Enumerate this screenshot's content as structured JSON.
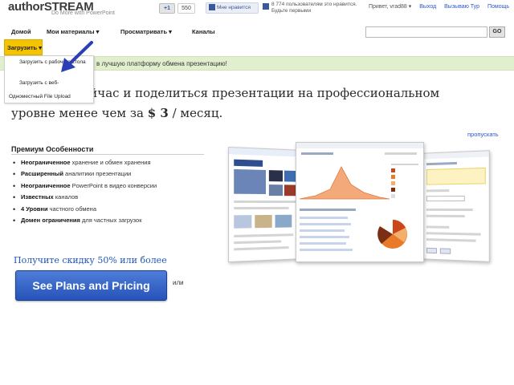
{
  "header": {
    "logo_author": "author",
    "logo_stream": "STREAM",
    "tagline": "Do More with PowerPoint",
    "gplus_label": "+1",
    "gplus_count": "550",
    "fb_like_label": "Мне нравится",
    "fb_text": "8 774 пользователям это нравится. Будьте первыми",
    "greeting": "Привет, vrad88 ▾",
    "links": [
      "Выход",
      "Вызываю Тур",
      "Помощь"
    ]
  },
  "nav": {
    "items": [
      "Домой",
      "Мои материалы ▾",
      "Просматривать ▾",
      "Каналы"
    ],
    "search_placeholder": "",
    "go_label": "GO"
  },
  "upload": {
    "button_label": "Загрузить ▾",
    "menu_items": [
      "Загрузить с рабочего стола",
      "Загрузить с веб-",
      "Одноместный File Upload"
    ]
  },
  "promo": {
    "text": "в лучшую платформу обмена презентацию!"
  },
  "headline": {
    "line1": "Обновить сейчас и поделиться презентации на профессиональном",
    "line2_prefix": "уровне менее чем за ",
    "price": "$ 3",
    "line2_suffix": " / месяц."
  },
  "skip_link": "пропускать",
  "features": {
    "title": "Премиум Особенности",
    "items": [
      {
        "bold": "Неограниченное",
        "rest": " хранение и обмен хранения"
      },
      {
        "bold": "Расширенный",
        "rest": " аналитики презентации"
      },
      {
        "bold": "Неограниченное",
        "rest": " PowerPoint в видео конверсии"
      },
      {
        "bold": "Известных",
        "rest": " каналов"
      },
      {
        "bold": "4 Уровни",
        "rest": " частного обмена"
      },
      {
        "bold": "Домен ограничения",
        "rest": " для частных загрузок"
      }
    ]
  },
  "discount_text": "Получите скидку 50% или более",
  "cta_label": "See Plans and Pricing",
  "or_text": "или",
  "colors": {
    "upload_yellow": "#f4c400",
    "promo_green": "#e1efcf",
    "cta_blue": "#2653b8",
    "link_blue": "#2a56c6"
  }
}
